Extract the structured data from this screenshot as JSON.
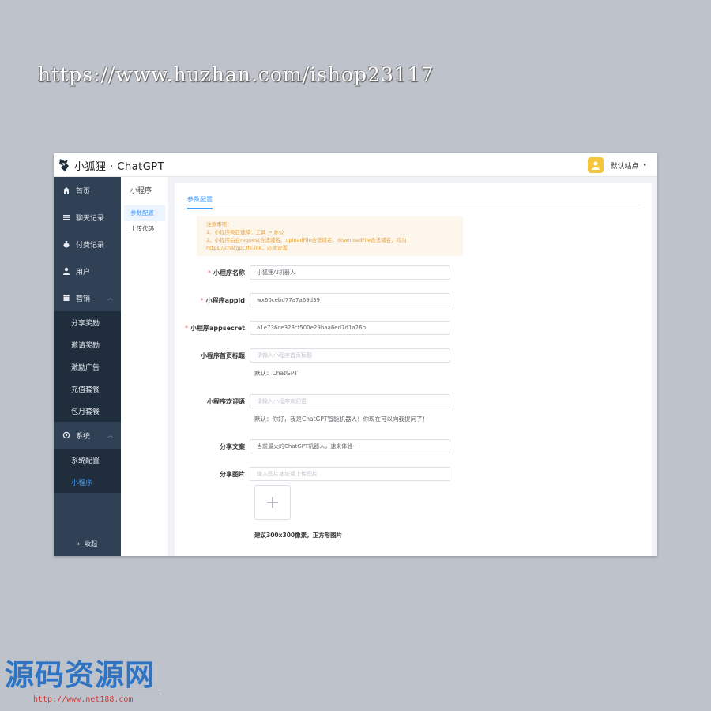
{
  "watermarks": {
    "top_url": "https://www.huzhan.com/ishop23117",
    "bottom_brand": "源码资源网",
    "bottom_url": "http://www.net188.com"
  },
  "header": {
    "logo_text": "小狐狸 · ChatGPT",
    "user_name": "默认站点",
    "caret": "▾"
  },
  "sidebar": {
    "items": [
      {
        "label": "首页",
        "icon": "home-icon"
      },
      {
        "label": "聊天记录",
        "icon": "list-icon"
      },
      {
        "label": "付费记录",
        "icon": "money-bag-icon"
      },
      {
        "label": "用户",
        "icon": "user-icon"
      },
      {
        "label": "营销",
        "icon": "shop-icon"
      }
    ],
    "marketing_sub": [
      "分享奖励",
      "邀请奖励",
      "激励广告",
      "充值套餐",
      "包月套餐"
    ],
    "system_label": "系统",
    "system_sub": [
      "系统配置",
      "小程序"
    ],
    "collapse_label": "← 收起"
  },
  "subnav": {
    "title": "小程序",
    "items": [
      "参数配置",
      "上传代码"
    ]
  },
  "content": {
    "tab_label": "参数配置",
    "notice": [
      "注意事项：",
      "1、小程序类目选择：工具 → 办公",
      "2、小程序后台request合法域名、uploadFile合法域名、downloadFile合法域名，均为：",
      "https://chatgpt.ffk.ink，必须设置"
    ],
    "fields": {
      "name": {
        "label": "小程序名称",
        "value": "小狐狸AI机器人"
      },
      "appid": {
        "label": "小程序appid",
        "value": "wx60cebd77a7a69d39"
      },
      "appsecret": {
        "label": "小程序appsecret",
        "value": "a1e736ce323cf500e29baa6ed7d1a26b"
      },
      "home_title": {
        "label": "小程序首页标题",
        "placeholder": "请输入小程序首页标题",
        "hint": "默认：ChatGPT"
      },
      "welcome": {
        "label": "小程序欢迎语",
        "placeholder": "请输入小程序欢迎语",
        "hint": "默认：你好，我是ChatGPT智能机器人！你现在可以向我提问了！"
      },
      "share_text": {
        "label": "分享文案",
        "value": "当前最火的ChatGPT机器人，速来体验~"
      },
      "share_image": {
        "label": "分享图片",
        "placeholder": "输入图片地址或上传图片"
      }
    },
    "upload_tip": "建议300x300像素，正方形图片",
    "required_mark": "*"
  }
}
